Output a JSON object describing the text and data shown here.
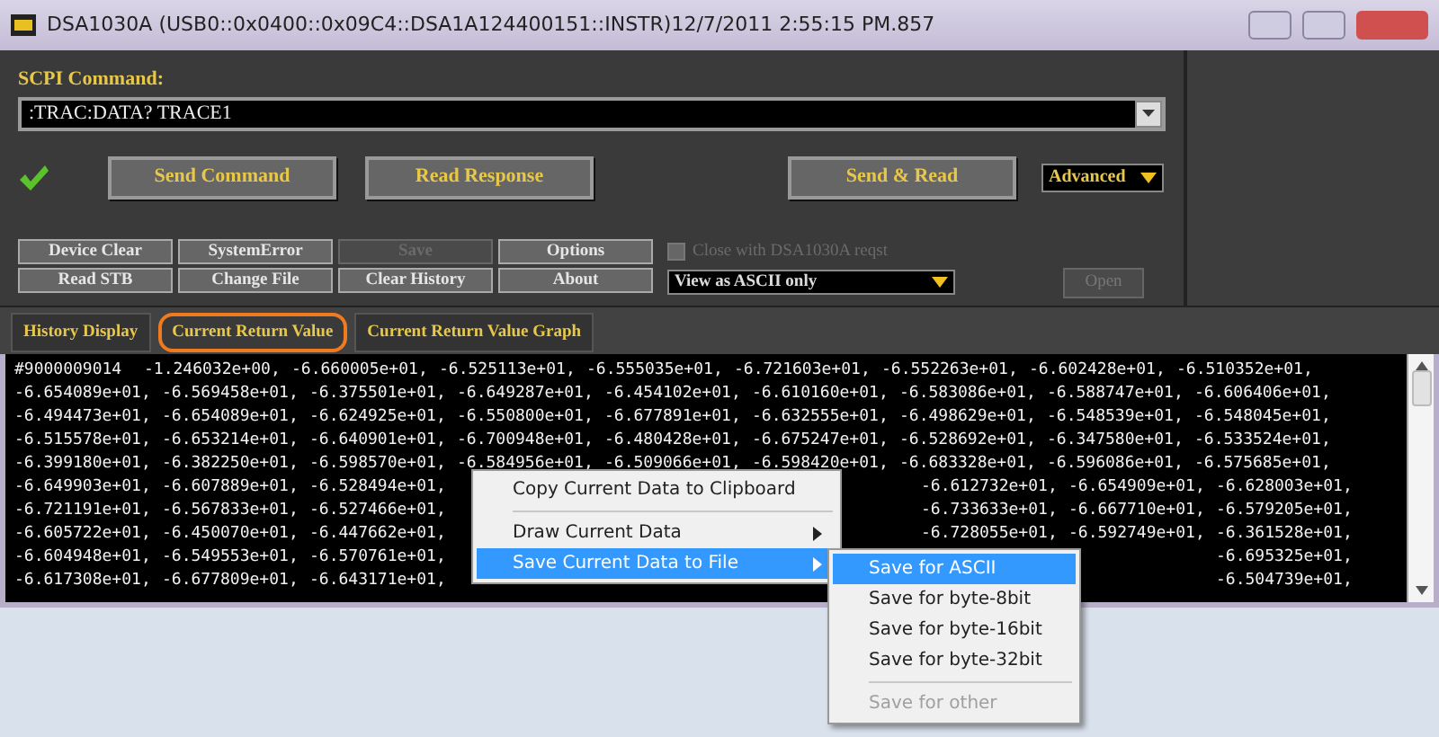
{
  "window": {
    "title": "DSA1030A (USB0::0x0400::0x09C4::DSA1A124400151::INSTR)12/7/2011 2:55:15 PM.857"
  },
  "command": {
    "label": "SCPI Command:",
    "value": ":TRAC:DATA? TRACE1"
  },
  "buttons": [
    {
      "label": "Send Command"
    },
    {
      "label": "Read Response"
    },
    {
      "label": "Send & Read"
    }
  ],
  "mode_select": {
    "value": "Advanced"
  },
  "small_buttons": [
    {
      "label": "Device Clear",
      "disabled": false
    },
    {
      "label": "SystemError",
      "disabled": false
    },
    {
      "label": "Save",
      "disabled": true
    },
    {
      "label": "Options",
      "disabled": false
    },
    {
      "label": "Read STB",
      "disabled": false
    },
    {
      "label": "Change File",
      "disabled": false
    },
    {
      "label": "Clear History",
      "disabled": false
    },
    {
      "label": "About",
      "disabled": false
    }
  ],
  "close_option": {
    "label": "Close with DSA1030A reqst",
    "checked": false,
    "disabled": true
  },
  "view_select": {
    "value": "View as ASCII only"
  },
  "open_button": {
    "label": "Open",
    "disabled": true
  },
  "tabs": [
    {
      "label": "History Display",
      "selected": false
    },
    {
      "label": "Current Return Value",
      "selected": true
    },
    {
      "label": "Current Return Value Graph",
      "selected": false
    }
  ],
  "data_rows": [
    {
      "left": [
        "#9000009014",
        "-1.246032e+00,",
        "-6.660005e+01,",
        "-6.525113e+01,",
        "-6.555035e+01,",
        "-6.721603e+01,",
        "-6.552263e+01,",
        "-6.602428e+01,",
        "-6.510352e+01,"
      ],
      "right": []
    },
    {
      "left": [
        "-6.654089e+01,",
        "-6.569458e+01,",
        "-6.375501e+01,",
        "-6.649287e+01,",
        "-6.454102e+01,",
        "-6.610160e+01,",
        "-6.583086e+01,",
        "-6.588747e+01,",
        "-6.606406e+01,"
      ],
      "right": []
    },
    {
      "left": [
        "-6.494473e+01,",
        "-6.654089e+01,",
        "-6.624925e+01,",
        "-6.550800e+01,",
        "-6.677891e+01,",
        "-6.632555e+01,",
        "-6.498629e+01,",
        "-6.548539e+01,",
        "-6.548045e+01,"
      ],
      "right": []
    },
    {
      "left": [
        "-6.515578e+01,",
        "-6.653214e+01,",
        "-6.640901e+01,",
        "-6.700948e+01,",
        "-6.480428e+01,",
        "-6.675247e+01,",
        "-6.528692e+01,",
        "-6.347580e+01,",
        "-6.533524e+01,"
      ],
      "right": []
    },
    {
      "left": [
        "-6.399180e+01,",
        "-6.382250e+01,",
        "-6.598570e+01,",
        "-6.584956e+01,",
        "-6.509066e+01,",
        "-6.598420e+01,",
        "-6.683328e+01,",
        "-6.596086e+01,",
        "-6.575685e+01,"
      ],
      "right": []
    },
    {
      "left": [
        "-6.649903e+01,",
        "-6.607889e+01,",
        "-6.528494e+01,"
      ],
      "right": [
        "-6.612732e+01,",
        "-6.654909e+01,",
        "-6.628003e+01,"
      ]
    },
    {
      "left": [
        "-6.721191e+01,",
        "-6.567833e+01,",
        "-6.527466e+01,"
      ],
      "right": [
        "-6.733633e+01,",
        "-6.667710e+01,",
        "-6.579205e+01,"
      ]
    },
    {
      "left": [
        "-6.605722e+01,",
        "-6.450070e+01,",
        "-6.447662e+01,"
      ],
      "right": [
        "-6.728055e+01,",
        "-6.592749e+01,",
        "-6.361528e+01,"
      ]
    },
    {
      "left": [
        "-6.604948e+01,",
        "-6.549553e+01,",
        "-6.570761e+01,"
      ],
      "right": [
        "-6.695325e+01,"
      ]
    },
    {
      "left": [
        "-6.617308e+01,",
        "-6.677809e+01,",
        "-6.643171e+01,"
      ],
      "right": [
        "-6.504739e+01,"
      ]
    }
  ],
  "context_menu": {
    "items": [
      {
        "kind": "item",
        "label": "Copy Current Data to Clipboard",
        "has_submenu": false,
        "selected": false
      },
      {
        "kind": "separator"
      },
      {
        "kind": "item",
        "label": "Draw Current Data",
        "has_submenu": true,
        "selected": false
      },
      {
        "kind": "item",
        "label": "Save Current Data to File",
        "has_submenu": true,
        "selected": true
      }
    ]
  },
  "submenu": {
    "items": [
      {
        "kind": "item",
        "label": "Save for ASCII",
        "selected": true,
        "disabled": false
      },
      {
        "kind": "item",
        "label": "Save for byte-8bit",
        "selected": false,
        "disabled": false
      },
      {
        "kind": "item",
        "label": "Save for byte-16bit",
        "selected": false,
        "disabled": false
      },
      {
        "kind": "item",
        "label": "Save for byte-32bit",
        "selected": false,
        "disabled": false
      },
      {
        "kind": "separator"
      },
      {
        "kind": "item",
        "label": "Save for other",
        "selected": false,
        "disabled": true
      }
    ]
  }
}
